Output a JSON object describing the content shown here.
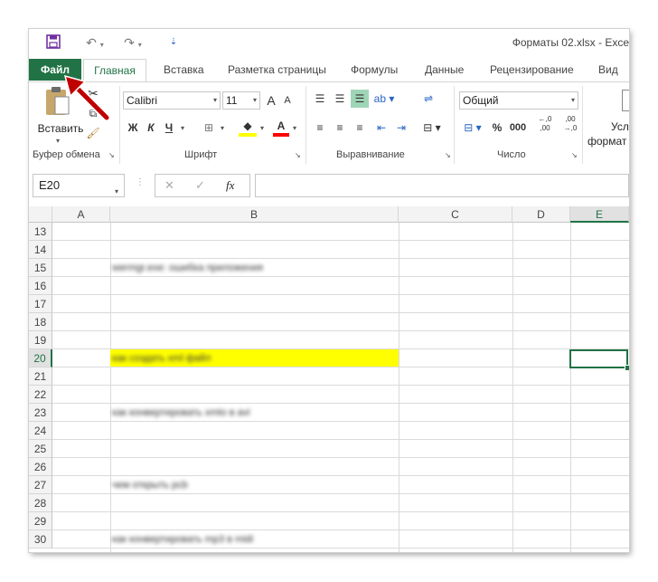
{
  "window": {
    "title": "Форматы 02.xlsx - Exce"
  },
  "qat": {
    "save_icon": "save-icon",
    "undo_icon": "undo-icon",
    "redo_icon": "redo-icon",
    "customize_icon": "customize-icon"
  },
  "tabs": [
    {
      "label": "Файл"
    },
    {
      "label": "Главная"
    },
    {
      "label": "Вставка"
    },
    {
      "label": "Разметка страницы"
    },
    {
      "label": "Формулы"
    },
    {
      "label": "Данные"
    },
    {
      "label": "Рецензирование"
    },
    {
      "label": "Вид"
    }
  ],
  "ribbon": {
    "clipboard": {
      "paste_label": "Вставить",
      "group_label": "Буфер обмена"
    },
    "font": {
      "name": "Calibri",
      "size": "11",
      "grow": "A",
      "shrink": "A",
      "bold": "Ж",
      "italic": "К",
      "underline": "Ч",
      "font_color": "A",
      "group_label": "Шрифт"
    },
    "alignment": {
      "group_label": "Выравнивание"
    },
    "number": {
      "format": "Общий",
      "percent": "%",
      "thousands": "000",
      "inc_decimal": "←,0 ,00",
      "dec_decimal": ",00 →,0",
      "group_label": "Число"
    },
    "styles": {
      "label_line1": "Усл",
      "label_line2": "формат"
    }
  },
  "formula_bar": {
    "cell_ref": "E20",
    "fx": "fx",
    "cancel": "✕",
    "enter": "✓",
    "value": ""
  },
  "sheet": {
    "columns": [
      "A",
      "B",
      "C",
      "D",
      "E"
    ],
    "selected_column": "E",
    "selected_row": "20",
    "rows": [
      {
        "num": "13",
        "b": ""
      },
      {
        "num": "14",
        "b": ""
      },
      {
        "num": "15",
        "b": "wermgr.exe: ошибка приложения"
      },
      {
        "num": "16",
        "b": ""
      },
      {
        "num": "17",
        "b": ""
      },
      {
        "num": "18",
        "b": ""
      },
      {
        "num": "19",
        "b": ""
      },
      {
        "num": "20",
        "b": "как создать xml файл"
      },
      {
        "num": "21",
        "b": ""
      },
      {
        "num": "22",
        "b": ""
      },
      {
        "num": "23",
        "b": "как конвертировать xmto в avi"
      },
      {
        "num": "24",
        "b": ""
      },
      {
        "num": "25",
        "b": ""
      },
      {
        "num": "26",
        "b": ""
      },
      {
        "num": "27",
        "b": "чем открыть pcb"
      },
      {
        "num": "28",
        "b": ""
      },
      {
        "num": "29",
        "b": ""
      },
      {
        "num": "30",
        "b": "как конвертировать mp3 в midi"
      }
    ],
    "highlight_color": "#ffff00"
  },
  "colors": {
    "accent": "#217346",
    "arrow": "#c00000"
  }
}
